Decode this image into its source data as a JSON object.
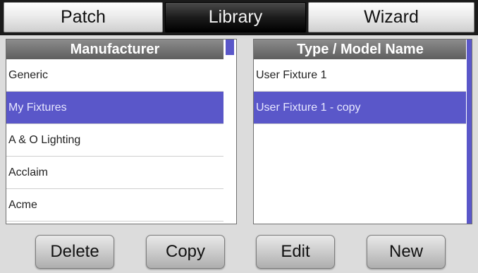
{
  "tabs": {
    "patch": "Patch",
    "library": "Library",
    "wizard": "Wizard",
    "active": "library"
  },
  "manufacturer_list": {
    "header": "Manufacturer",
    "items": [
      "Generic",
      "My Fixtures",
      "A & O Lighting",
      "Acclaim",
      "Acme"
    ],
    "selected_index": 1
  },
  "model_list": {
    "header": "Type / Model Name",
    "items": [
      "User Fixture 1",
      "User Fixture 1 - copy"
    ],
    "selected_index": 1
  },
  "buttons": {
    "delete": "Delete",
    "copy": "Copy",
    "edit": "Edit",
    "new": "New"
  },
  "colors": {
    "selection": "#5a57c9",
    "header": "#6e6e6e"
  }
}
